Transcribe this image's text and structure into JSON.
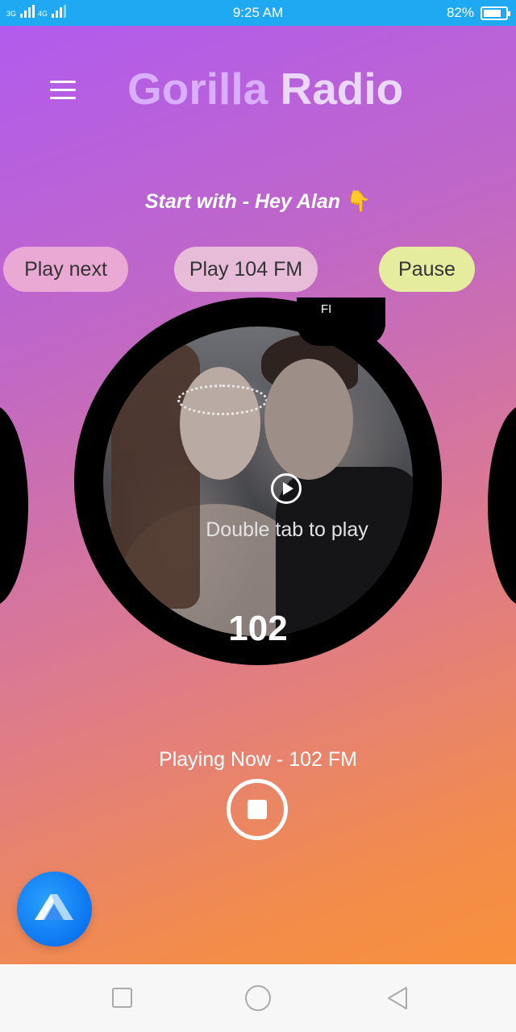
{
  "status_bar": {
    "network_left": "3G",
    "network_right": "4G",
    "time": "9:25 AM",
    "battery_text": "82%",
    "battery_level": 0.82,
    "icons": [
      "signal-icon",
      "signal-icon",
      "battery-icon"
    ]
  },
  "header": {
    "title_part1": "Gorilla",
    "title_part2": "Radio",
    "menu_icon": "hamburger-menu-icon"
  },
  "hint": {
    "text": "Start with - Hey Alan",
    "emoji": "👇"
  },
  "chips": {
    "play_next": "Play next",
    "play_104": "Play 104 FM",
    "pause": "Pause"
  },
  "station": {
    "tab_label": "FI",
    "action_hint": "Double tab to play",
    "frequency": "102",
    "play_icon": "play-circle-icon"
  },
  "now_playing": {
    "text": "Playing Now - 102 FM",
    "stop_icon": "stop-circle-icon"
  },
  "assistant": {
    "icon": "alan-assistant-icon",
    "color": "#1a8cff"
  },
  "nav_bar": {
    "icons": [
      "recent-apps-icon",
      "home-icon",
      "back-icon"
    ]
  },
  "colors": {
    "status_bar": "#1fa9f3",
    "gradient_top": "#b15bee",
    "gradient_bottom": "#f7913c",
    "chip_play_next": "#eaa8d4",
    "chip_play_104": "#e6bcd8",
    "chip_pause": "#e5ec9e"
  }
}
